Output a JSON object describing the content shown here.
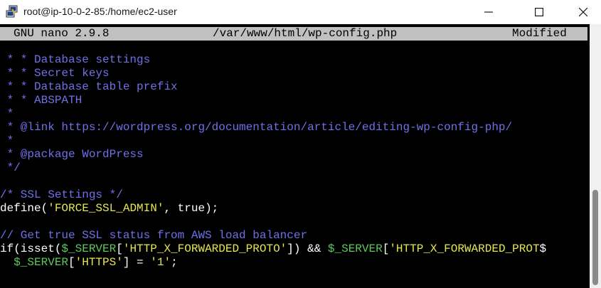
{
  "window": {
    "title": "root@ip-10-0-2-85:/home/ec2-user",
    "icon": "putty-terminal-icon",
    "controls": [
      "minimize-icon",
      "maximize-icon",
      "close-icon"
    ]
  },
  "nano": {
    "version": "GNU nano 2.9.8",
    "file": "/var/www/html/wp-config.php",
    "state": "Modified"
  },
  "code": {
    "l1": " * * Database settings",
    "l2": " * * Secret keys",
    "l3": " * * Database table prefix",
    "l4": " * * ABSPATH",
    "l5": " *",
    "l6": " * @link https://wordpress.org/documentation/article/editing-wp-config-php/",
    "l7": " *",
    "l8": " * @package WordPress",
    "l9": " */",
    "l10": "/* SSL Settings */",
    "l11": {
      "a": "define(",
      "b": "'FORCE_SSL_ADMIN'",
      "c": ", true);"
    },
    "l12": "// Get true SSL status from AWS load balancer",
    "l13": {
      "a": "if(isset(",
      "b": "$_SERVER",
      "c": "[",
      "d": "'HTTP_X_FORWARDED_PROTO'",
      "e": "]) && ",
      "f": "$_SERVER",
      "g": "[",
      "h": "'HTTP_X_FORWARDED_PROT",
      "i": "$"
    },
    "l14": {
      "a": "  ",
      "b": "$_SERVER",
      "c": "[",
      "d": "'HTTPS'",
      "e": "] = ",
      "f": "'1'",
      "g": ";"
    }
  },
  "colors": {
    "comment": "#7070e8",
    "string": "#e6e650",
    "variable": "#5cc85c",
    "header_bg": "#c0c0c0"
  }
}
